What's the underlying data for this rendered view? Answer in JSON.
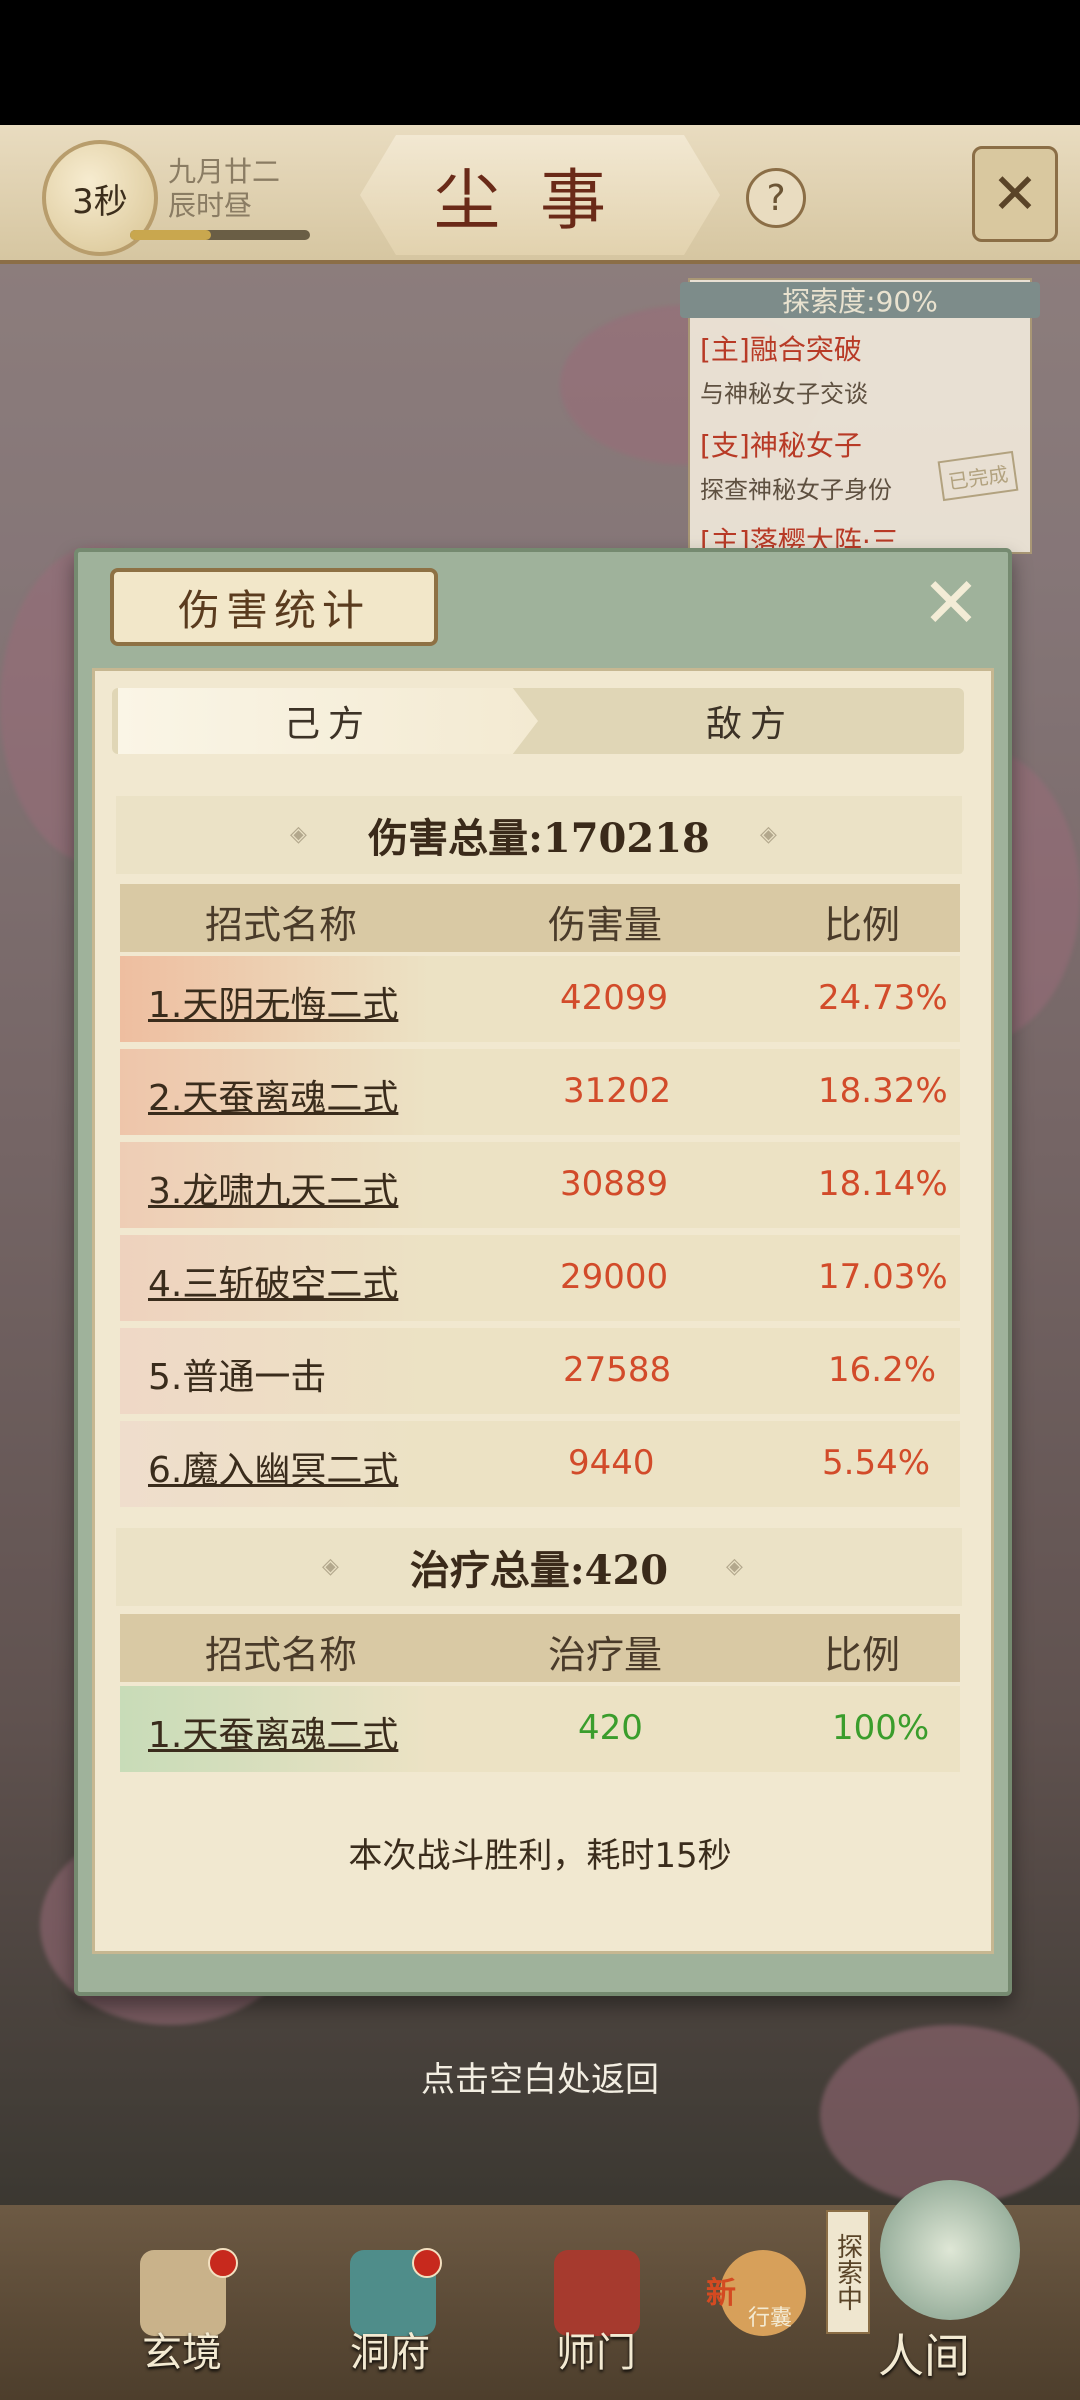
{
  "header": {
    "countdown": "3秒",
    "date_line1": "九月廿二",
    "date_line2": "辰时昼",
    "title": "尘事",
    "help_icon": "question-icon",
    "close_icon": "close-icon"
  },
  "quest_panel": {
    "progress_label": "探索度:90%",
    "items": [
      {
        "title": "[主]融合突破",
        "desc": "与神秘女子交谈"
      },
      {
        "title": "[支]神秘女子",
        "desc": "探查神秘女子身份",
        "badge": "已完成"
      },
      {
        "title": "[主]落樱大阵·三"
      }
    ]
  },
  "modal": {
    "title": "伤害统计",
    "tabs": {
      "own": "己方",
      "enemy": "敌方",
      "active": "own"
    },
    "damage": {
      "title": "伤害总量:170218",
      "headers": {
        "name": "招式名称",
        "amount": "伤害量",
        "ratio": "比例"
      },
      "rows": [
        {
          "name": "1.天阴无悔二式",
          "amount": "42099",
          "ratio": "24.73%",
          "linked": true
        },
        {
          "name": "2.天蚕离魂二式",
          "amount": "31202",
          "ratio": "18.32%",
          "linked": true
        },
        {
          "name": "3.龙啸九天二式",
          "amount": "30889",
          "ratio": "18.14%",
          "linked": true
        },
        {
          "name": "4.三斩破空二式",
          "amount": "29000",
          "ratio": "17.03%",
          "linked": true
        },
        {
          "name": "5.普通一击",
          "amount": "27588",
          "ratio": "16.2%",
          "linked": false
        },
        {
          "name": "6.魔入幽冥二式",
          "amount": "9440",
          "ratio": "5.54%",
          "linked": true
        }
      ]
    },
    "healing": {
      "title": "治疗总量:420",
      "headers": {
        "name": "招式名称",
        "amount": "治疗量",
        "ratio": "比例"
      },
      "rows": [
        {
          "name": "1.天蚕离魂二式",
          "amount": "420",
          "ratio": "100%",
          "linked": true
        }
      ]
    },
    "result": "本次战斗胜利，耗时15秒"
  },
  "hint": "点击空白处返回",
  "bottom_nav": {
    "items": [
      "玄境",
      "洞府",
      "师门",
      "人间"
    ],
    "bag_badge": "新",
    "bag_label": "行囊",
    "explore_badge": "探索中"
  },
  "colors": {
    "damage_text": "#d24b2a",
    "heal_text": "#3a9d2c",
    "title_red": "#6a2a18",
    "panel_green": "#9fb29b"
  }
}
